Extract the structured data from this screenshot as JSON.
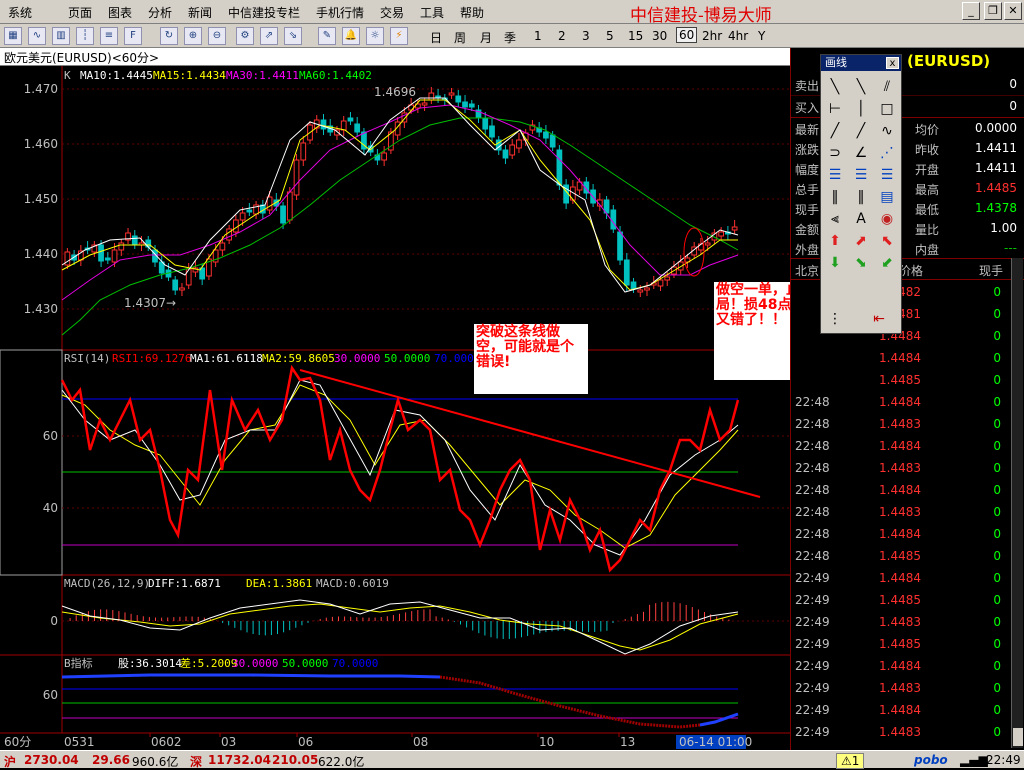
{
  "menu": {
    "items": [
      "系统",
      "页面",
      "图表",
      "分析",
      "新闻",
      "中信建投专栏",
      "手机行情",
      "交易",
      "工具",
      "帮助"
    ],
    "brand": "中信建投-博易大师"
  },
  "toolbar": {
    "periods": [
      "日",
      "周",
      "月",
      "季",
      "1",
      "2",
      "3",
      "5",
      "15",
      "30",
      "60",
      "2hr",
      "4hr",
      "Y"
    ],
    "selected_period": "60"
  },
  "window_title": "欧元美元(EURUSD)<60分>",
  "price_panel": {
    "header_k": "K",
    "ma": [
      {
        "label": "MA10:1.4445",
        "color": "#ffffff"
      },
      {
        "label": "MA15:1.4434",
        "color": "#ffff00"
      },
      {
        "label": "MA30:1.4411",
        "color": "#ff00ff"
      },
      {
        "label": "MA60:1.4402",
        "color": "#00ff00"
      }
    ],
    "yticks": [
      "1.470",
      "1.460",
      "1.450",
      "1.440",
      "1.430"
    ],
    "high_label": "1.4696",
    "low_label": "1.4307→"
  },
  "rsi_panel": {
    "header": [
      {
        "label": "RSI(14)",
        "color": "#c0c0c0"
      },
      {
        "label": "RSI1:69.1276",
        "color": "#ff0000"
      },
      {
        "label": "MA1:61.6118",
        "color": "#ffffff"
      },
      {
        "label": "MA2:59.8605",
        "color": "#ffff00"
      },
      {
        "label": "30.0000",
        "color": "#ff00ff"
      },
      {
        "label": "50.0000",
        "color": "#00ff00"
      },
      {
        "label": "70.0000",
        "color": "#0000ff"
      }
    ],
    "yticks": [
      "60",
      "40"
    ]
  },
  "macd_panel": {
    "header": [
      {
        "label": "MACD(26,12,9)",
        "color": "#c0c0c0"
      },
      {
        "label": "DIFF:1.6871",
        "color": "#ffffff"
      },
      {
        "label": "DEA:1.3861",
        "color": "#ffff00"
      },
      {
        "label": "MACD:0.6019",
        "color": "#c0c0c0"
      }
    ],
    "yticks": [
      "0"
    ]
  },
  "b_panel": {
    "header": [
      {
        "label": "B指标",
        "color": "#c0c0c0"
      },
      {
        "label": "股:36.3014",
        "color": "#ffffff"
      },
      {
        "label": "差:5.2009",
        "color": "#ffff00"
      },
      {
        "label": "30.0000",
        "color": "#ff00ff"
      },
      {
        "label": "50.0000",
        "color": "#00ff00"
      },
      {
        "label": "70.0000",
        "color": "#0000ff"
      }
    ],
    "yticks": [
      "60"
    ]
  },
  "xaxis": {
    "unit": "60分",
    "labels": [
      "0531",
      "0602",
      "03",
      "06",
      "08",
      "10",
      "13"
    ],
    "cursor_label": "06-14 01:00"
  },
  "annotations": {
    "note1": "突破这条线做空，可能就是个错误!",
    "note2": "做空一单，止损出局！损48点。方向又错了！！"
  },
  "quote": {
    "title": "(EURUSD)",
    "sell_label": "卖出",
    "sell_val": "0",
    "buy_label": "买入",
    "buy_val": "0",
    "rows": [
      {
        "l1": "最新",
        "v1": "",
        "l2": "均价",
        "v2": "0.0000",
        "c2": "#ffffff"
      },
      {
        "l1": "涨跌",
        "v1": "",
        "l2": "昨收",
        "v2": "1.4411",
        "c2": "#ffffff"
      },
      {
        "l1": "幅度",
        "v1": "",
        "l2": "开盘",
        "v2": "1.4411",
        "c2": "#ffffff"
      },
      {
        "l1": "总手",
        "v1": "",
        "l2": "最高",
        "v2": "1.4485",
        "c2": "#ff3030"
      },
      {
        "l1": "现手",
        "v1": "",
        "l2": "最低",
        "v2": "1.4378",
        "c2": "#00ff00"
      },
      {
        "l1": "金额",
        "v1": "",
        "l2": "量比",
        "v2": "1.00",
        "c2": "#ffffff"
      },
      {
        "l1": "外盘",
        "v1": "",
        "l2": "内盘",
        "v2": "---",
        "c2": "#00c000"
      }
    ],
    "tick_headers": [
      "北京",
      "价格",
      "现手"
    ],
    "ticks": [
      {
        "time": "",
        "price": "1.4482",
        "vol": "0"
      },
      {
        "time": "",
        "price": "1.4481",
        "vol": "0"
      },
      {
        "time": "",
        "price": "1.4484",
        "vol": "0"
      },
      {
        "time": "",
        "price": "1.4484",
        "vol": "0"
      },
      {
        "time": "",
        "price": "1.4485",
        "vol": "0"
      },
      {
        "time": "22:48",
        "price": "1.4484",
        "vol": "0"
      },
      {
        "time": "22:48",
        "price": "1.4483",
        "vol": "0"
      },
      {
        "time": "22:48",
        "price": "1.4484",
        "vol": "0"
      },
      {
        "time": "22:48",
        "price": "1.4483",
        "vol": "0"
      },
      {
        "time": "22:48",
        "price": "1.4484",
        "vol": "0"
      },
      {
        "time": "22:48",
        "price": "1.4483",
        "vol": "0"
      },
      {
        "time": "22:48",
        "price": "1.4484",
        "vol": "0"
      },
      {
        "time": "22:48",
        "price": "1.4485",
        "vol": "0"
      },
      {
        "time": "22:49",
        "price": "1.4484",
        "vol": "0"
      },
      {
        "time": "22:49",
        "price": "1.4485",
        "vol": "0"
      },
      {
        "time": "22:49",
        "price": "1.4483",
        "vol": "0"
      },
      {
        "time": "22:49",
        "price": "1.4485",
        "vol": "0"
      },
      {
        "time": "22:49",
        "price": "1.4484",
        "vol": "0"
      },
      {
        "time": "22:49",
        "price": "1.4483",
        "vol": "0"
      },
      {
        "time": "22:49",
        "price": "1.4484",
        "vol": "0"
      },
      {
        "time": "22:49",
        "price": "1.4483",
        "vol": "0"
      }
    ]
  },
  "drawing_panel": {
    "title": "画线",
    "close": "x",
    "text_tool": "A"
  },
  "status": {
    "sh_label": "沪",
    "sh_index": "2730.04",
    "sh_change": "29.66",
    "sh_amount": "960.6亿",
    "sz_label": "深",
    "sz_index": "11732.04",
    "sz_change": "210.05",
    "sz_amount": "622.0亿",
    "alert": "⚠1",
    "brand": "pobo",
    "time": "22:49"
  }
}
